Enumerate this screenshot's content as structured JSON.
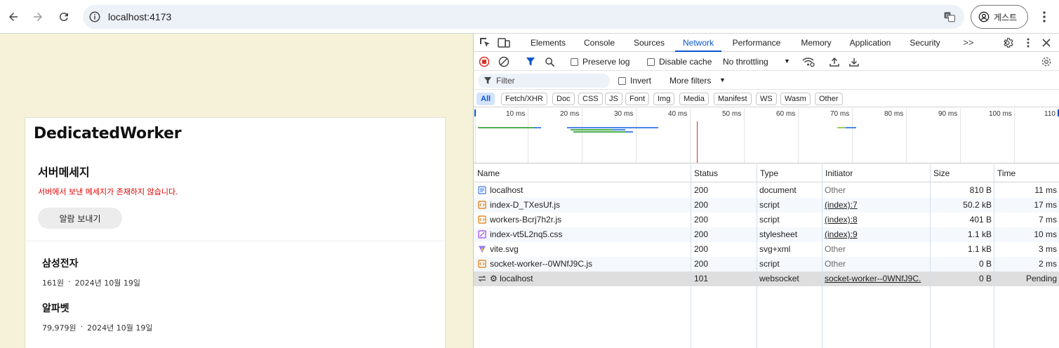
{
  "browser": {
    "url": "localhost:4173",
    "profile_label": "게스트"
  },
  "page": {
    "title": "DedicatedWorker",
    "section_title": "서버메세지",
    "error_message": "서버에서 보낸 메세지가 존재하지 않습니다.",
    "alarm_button": "알람 보내기",
    "stocks": [
      {
        "name": "삼성전자",
        "price": "161원",
        "sep": "·",
        "date": "2024년 10월 19일"
      },
      {
        "name": "알파벳",
        "price": "79,979원",
        "sep": "·",
        "date": "2024년 10월 19일"
      }
    ]
  },
  "devtools": {
    "tabs": [
      "Elements",
      "Console",
      "Sources",
      "Network",
      "Performance",
      "Memory",
      "Application",
      "Security"
    ],
    "active_tab": "Network",
    "more_tabs": ">>",
    "toolbar": {
      "preserve_log": "Preserve log",
      "disable_cache": "Disable cache",
      "throttling": "No throttling"
    },
    "filter": {
      "placeholder": "Filter",
      "invert": "Invert",
      "more_filters": "More filters"
    },
    "type_filters": [
      "All",
      "Fetch/XHR",
      "Doc",
      "CSS",
      "JS",
      "Font",
      "Img",
      "Media",
      "Manifest",
      "WS",
      "Wasm",
      "Other"
    ],
    "overview_ticks": [
      "10 ms",
      "20 ms",
      "30 ms",
      "40 ms",
      "50 ms",
      "60 ms",
      "70 ms",
      "80 ms",
      "90 ms",
      "100 ms",
      "110"
    ],
    "columns": [
      "Name",
      "Status",
      "Type",
      "Initiator",
      "Size",
      "Time"
    ],
    "rows": [
      {
        "name": "localhost",
        "status": "200",
        "type": "document",
        "initiator": "Other",
        "size": "810 B",
        "time": "11 ms",
        "icon": "document-icon"
      },
      {
        "name": "index-D_TXesUf.js",
        "status": "200",
        "type": "script",
        "initiator": "(index):7",
        "size": "50.2 kB",
        "time": "17 ms",
        "icon": "script-icon"
      },
      {
        "name": "workers-Bcrj7h2r.js",
        "status": "200",
        "type": "script",
        "initiator": "(index):8",
        "size": "401 B",
        "time": "7 ms",
        "icon": "script-icon"
      },
      {
        "name": "index-vt5L2nq5.css",
        "status": "200",
        "type": "stylesheet",
        "initiator": "(index):9",
        "size": "1.1 kB",
        "time": "10 ms",
        "icon": "stylesheet-icon"
      },
      {
        "name": "vite.svg",
        "status": "200",
        "type": "svg+xml",
        "initiator": "Other",
        "size": "1.1 kB",
        "time": "3 ms",
        "icon": "vite-icon"
      },
      {
        "name": "socket-worker--0WNfJ9C.js",
        "status": "200",
        "type": "script",
        "initiator": "Other",
        "size": "0 B",
        "time": "2 ms",
        "icon": "script-icon"
      },
      {
        "name": "⚙ localhost",
        "status": "101",
        "type": "websocket",
        "initiator": "socket-worker--0WNfJ9C.",
        "size": "0 B",
        "time": "Pending",
        "icon": "websocket-icon"
      }
    ]
  },
  "colors": {
    "accent": "#0b57d0",
    "page_bg": "#f5f2d9",
    "error": "#e00000",
    "record": "#d93025"
  }
}
